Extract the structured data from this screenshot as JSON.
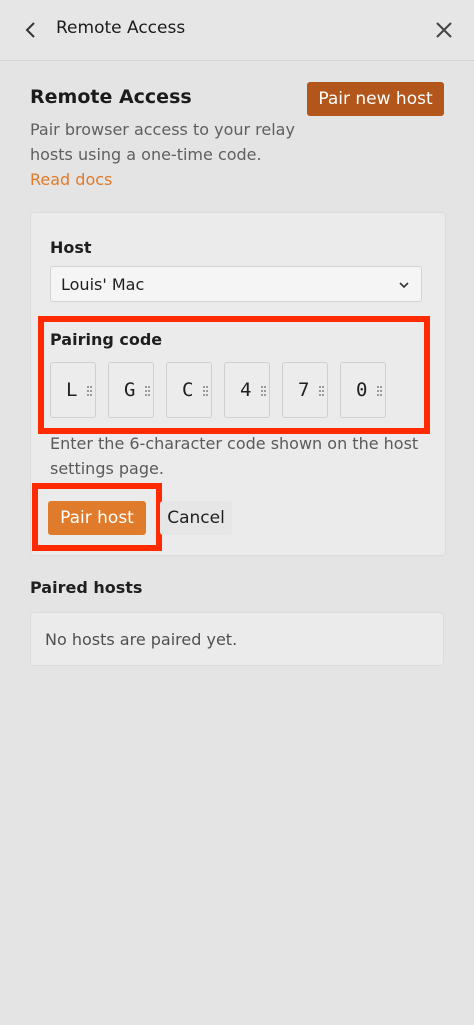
{
  "topbar": {
    "title": "Remote Access"
  },
  "section": {
    "heading": "Remote Access",
    "pair_new_label": "Pair new host",
    "description": "Pair browser access to your relay hosts using a one-time code.",
    "read_docs_label": "Read docs"
  },
  "form": {
    "host_label": "Host",
    "host_value": "Louis' Mac",
    "pairing_label": "Pairing code",
    "code": [
      "L",
      "G",
      "C",
      "4",
      "7",
      "0"
    ],
    "hint": "Enter the 6-character code shown on the host settings page.",
    "pair_host_label": "Pair host",
    "cancel_label": "Cancel"
  },
  "paired": {
    "heading": "Paired hosts",
    "empty_text": "No hosts are paired yet."
  },
  "colors": {
    "accent": "#e07b2b",
    "accent_dark": "#b2561c",
    "highlight": "#ff2a00"
  }
}
